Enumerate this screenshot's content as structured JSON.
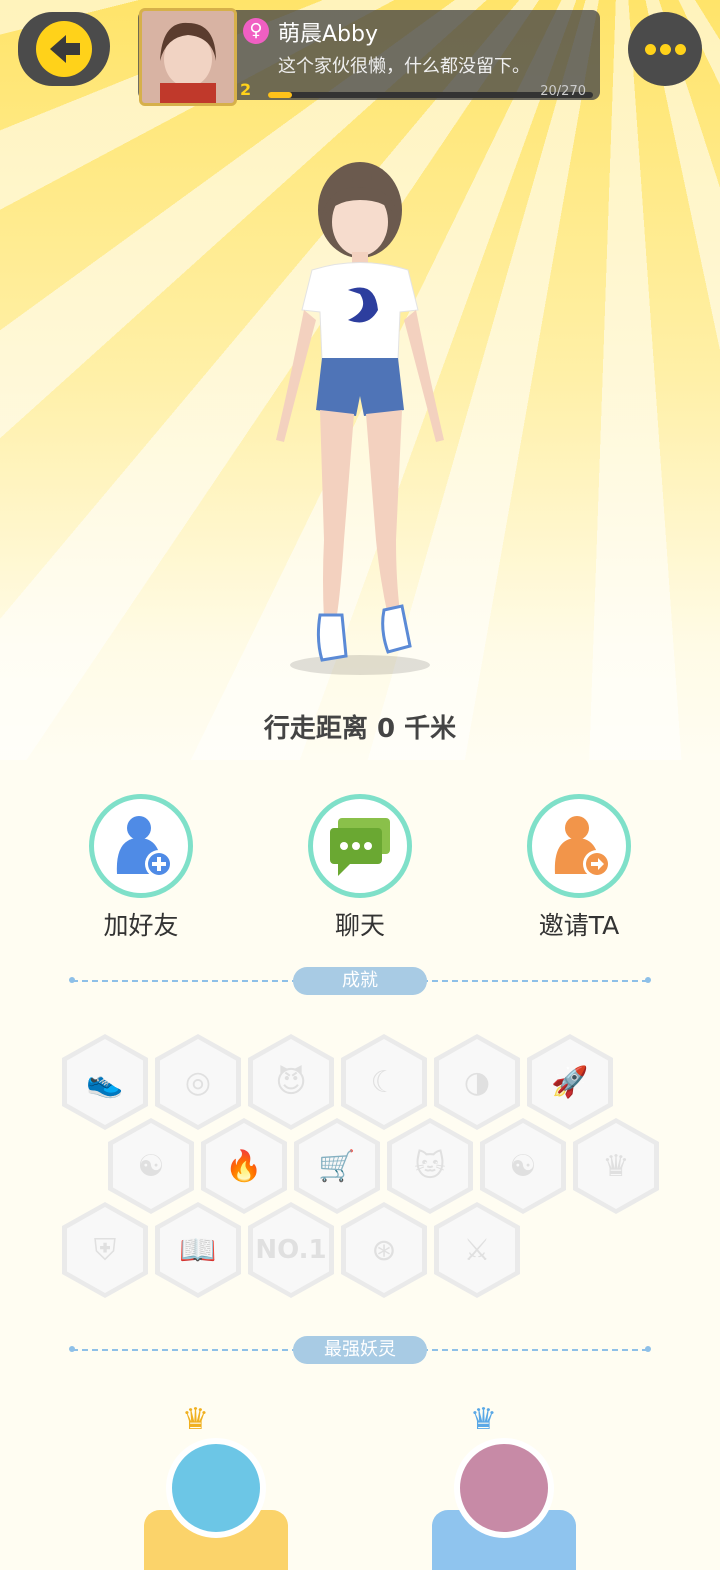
{
  "profile": {
    "gender_icon": "♀",
    "username": "萌晨Abby",
    "signature": "这个家伙很懒，什么都没留下。",
    "level": "2",
    "xp_text": "20/270",
    "xp_fraction": 0.074
  },
  "walk_distance": "行走距离 0 千米",
  "actions": [
    {
      "label": "加好友",
      "icon": "add-friend-icon"
    },
    {
      "label": "聊天",
      "icon": "chat-icon"
    },
    {
      "label": "邀请TA",
      "icon": "invite-icon"
    }
  ],
  "sections": {
    "achievements": "成就",
    "strongest_spirit": "最强妖灵"
  },
  "achievement_badges": {
    "no1_text": "NO.1"
  },
  "colors": {
    "accent_yellow": "#ffd21a",
    "ring_teal": "#7fe0c9",
    "section_pill": "#a8cbe4"
  }
}
